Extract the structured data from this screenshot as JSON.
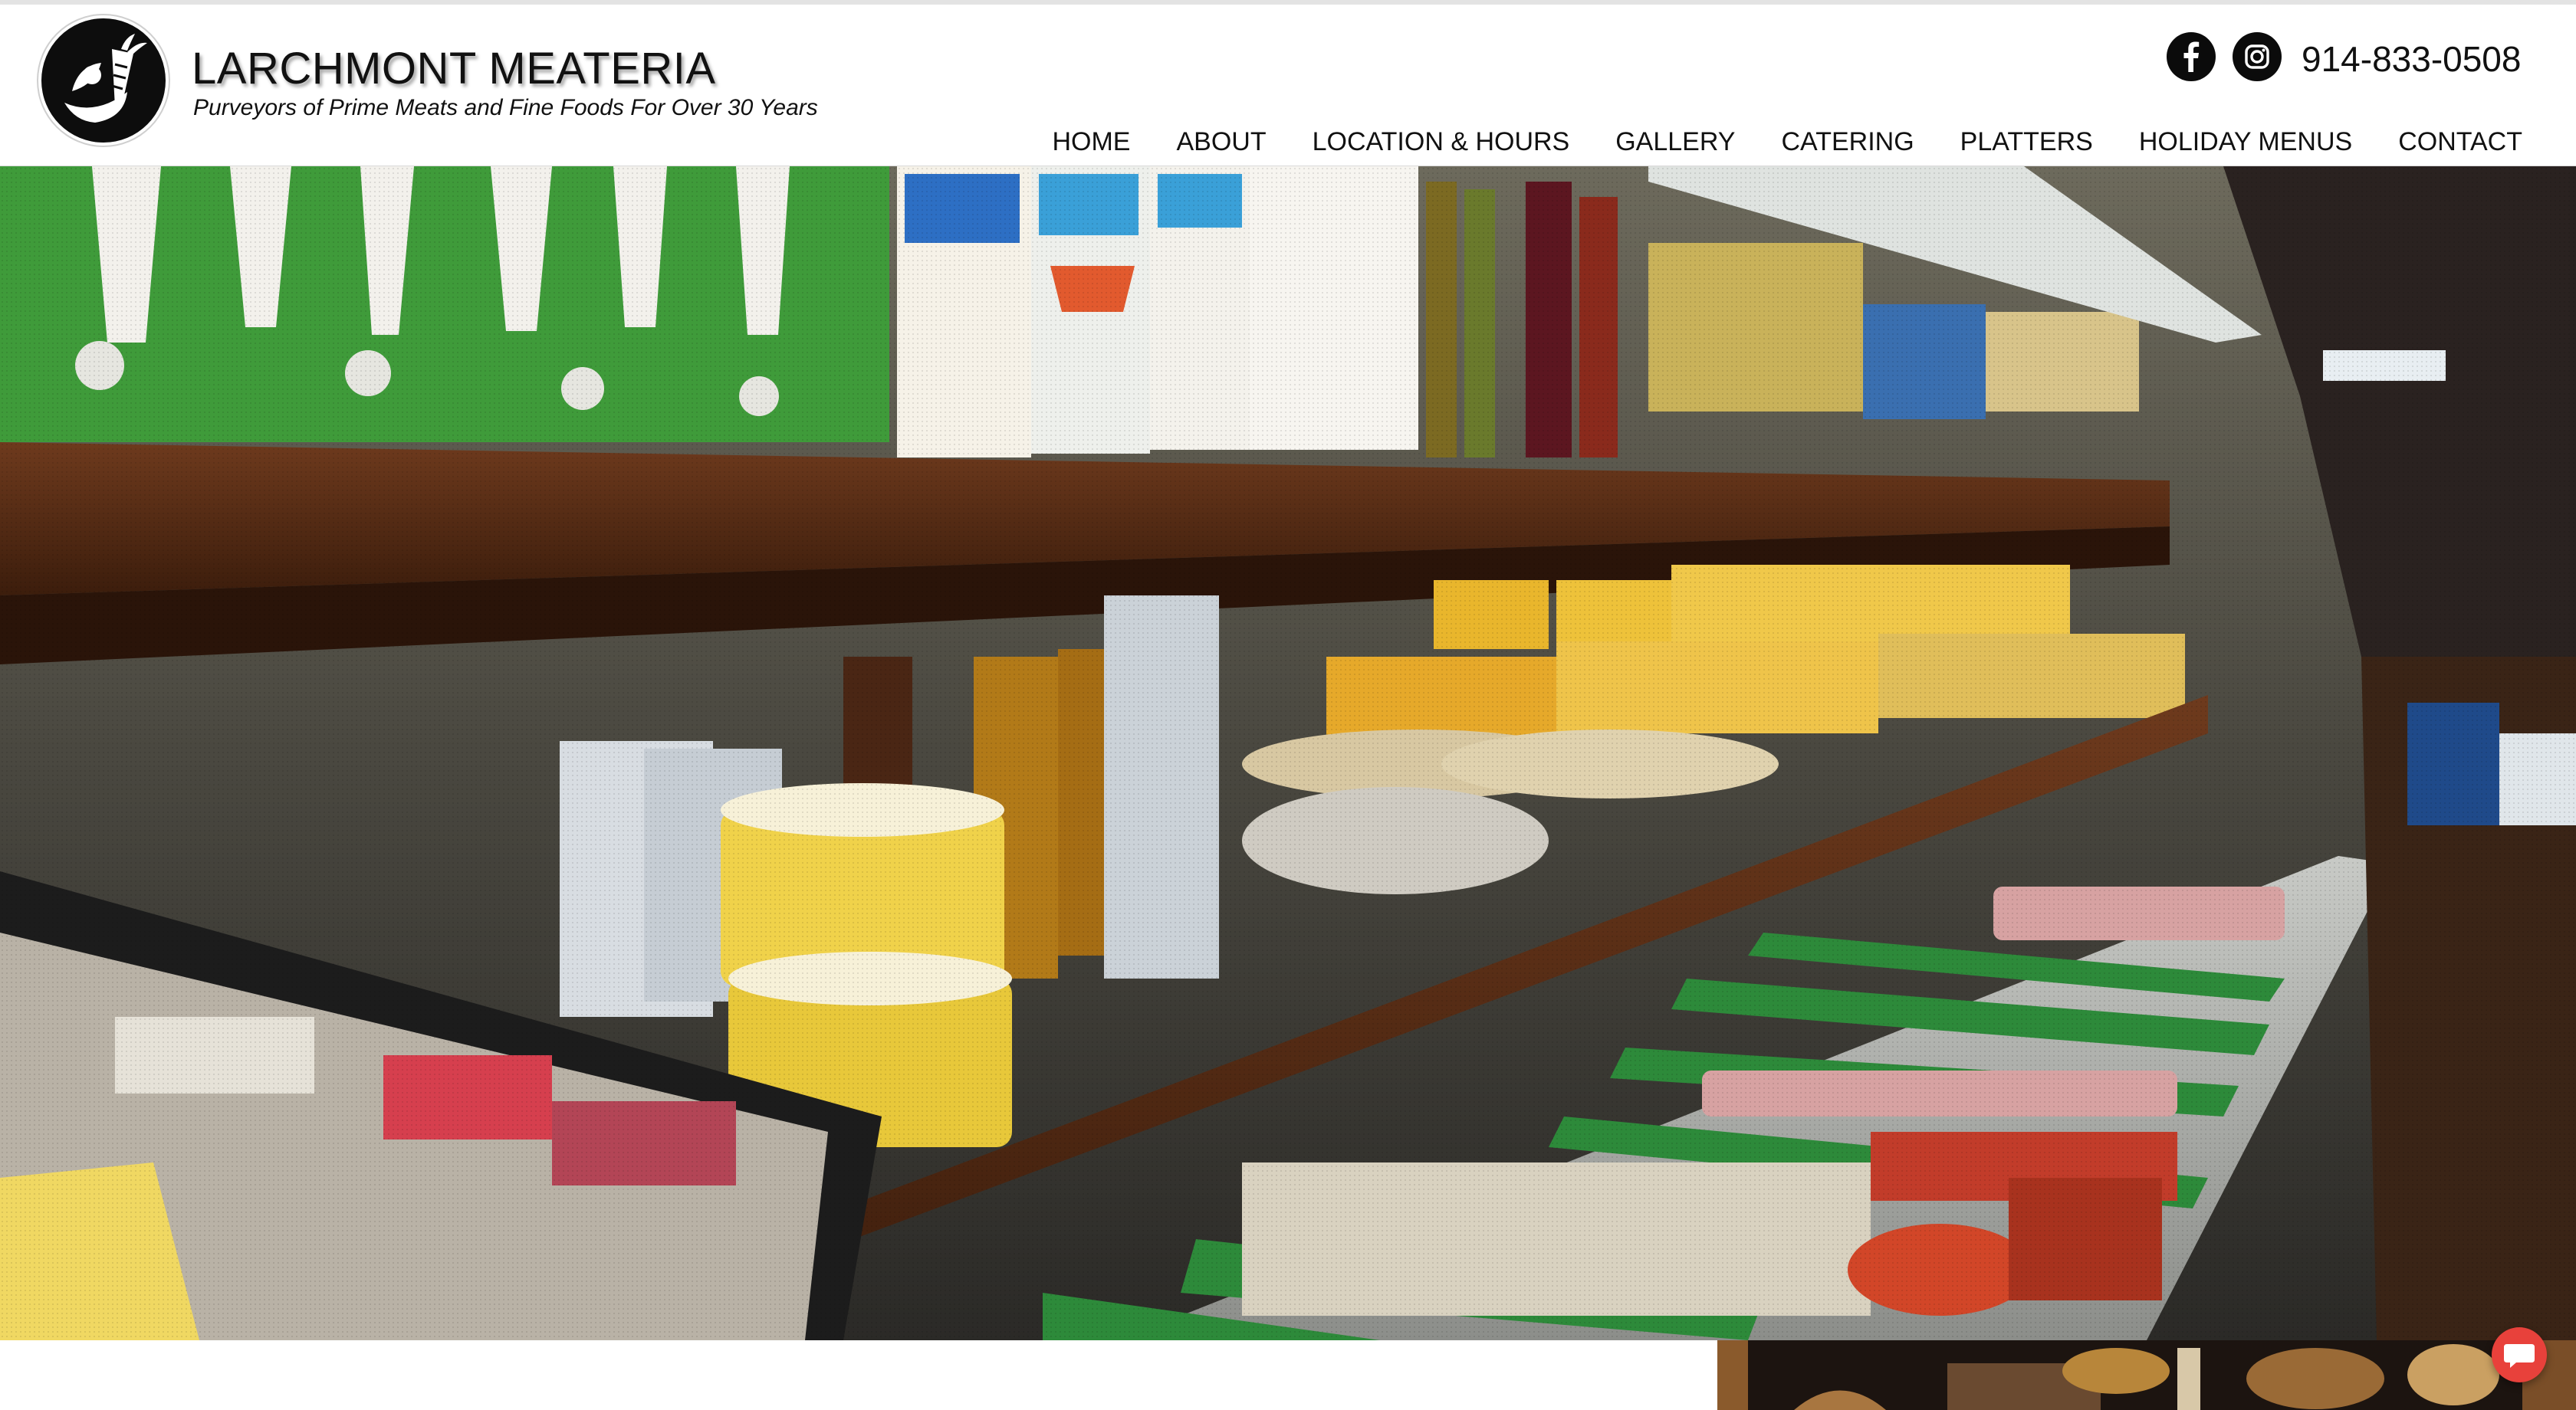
{
  "header": {
    "brand_name": "LARCHMONT MEATERIA",
    "tagline": "Purveyors of Prime Meats and Fine Foods For Over 30 Years",
    "logo_icon": "vegetables-logo-icon",
    "phone": "914-833-0508",
    "social": [
      {
        "name": "facebook",
        "icon": "facebook-icon"
      },
      {
        "name": "instagram",
        "icon": "instagram-icon"
      }
    ]
  },
  "nav": {
    "items": [
      {
        "label": "HOME"
      },
      {
        "label": "ABOUT"
      },
      {
        "label": "LOCATION & HOURS"
      },
      {
        "label": "GALLERY"
      },
      {
        "label": "CATERING"
      },
      {
        "label": "PLATTERS"
      },
      {
        "label": "HOLIDAY MENUS"
      },
      {
        "label": "CONTACT"
      }
    ]
  },
  "hero": {
    "media": "store shelves video background"
  },
  "chat": {
    "icon": "chat-icon"
  },
  "colors": {
    "text": "#111111",
    "header_bg": "#ffffff",
    "logo_bg": "#0d0d0d",
    "shelf_wood": "#5a2f17",
    "chat_button": "#e8413b"
  }
}
